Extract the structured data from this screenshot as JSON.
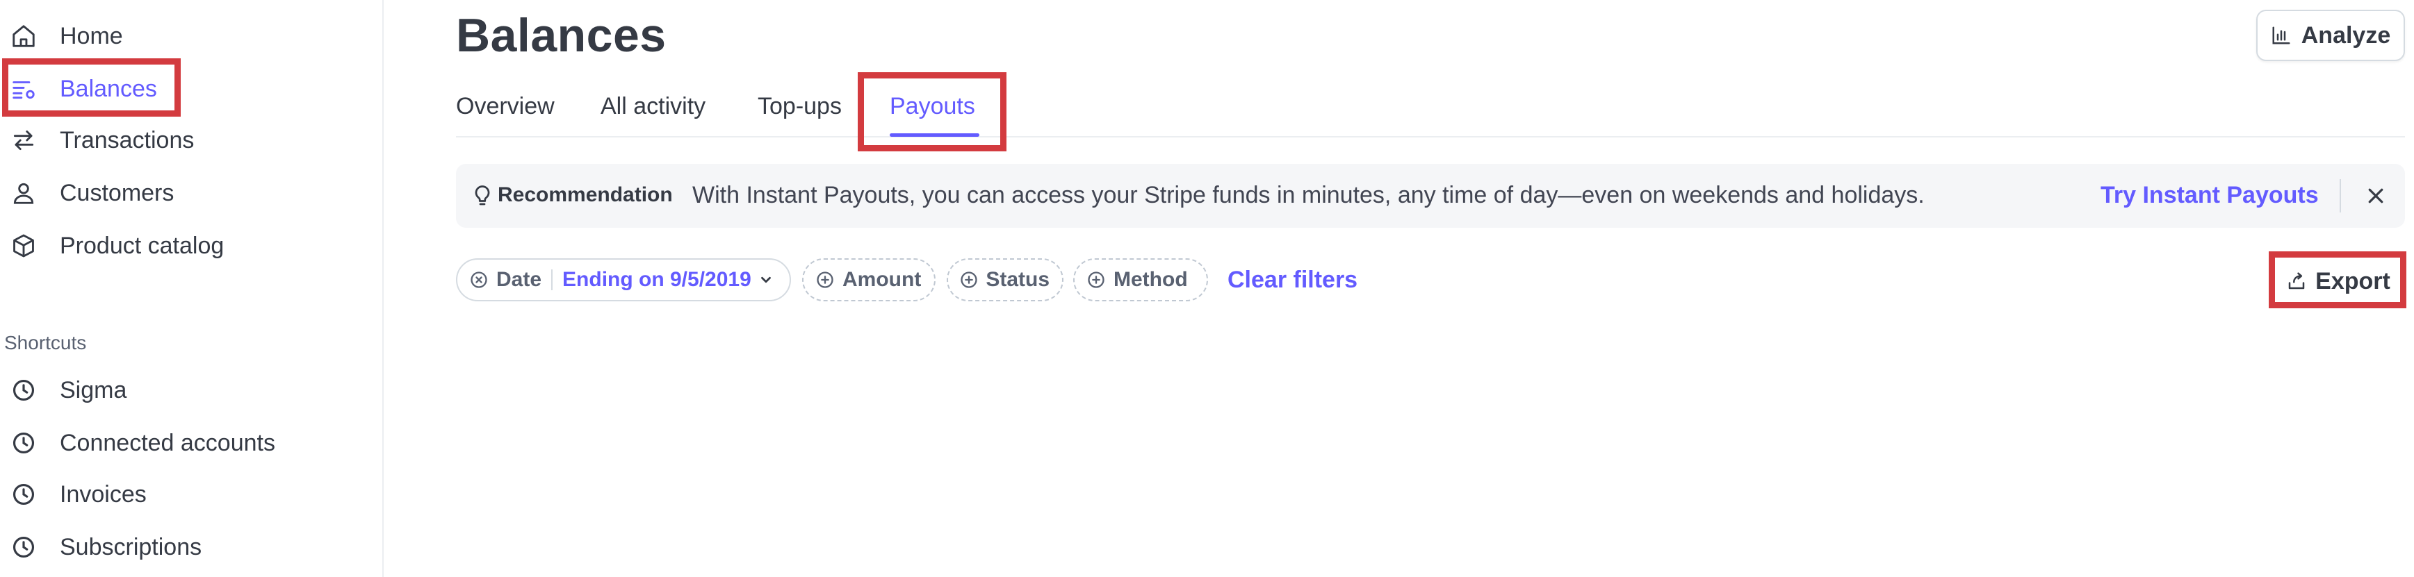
{
  "sidebar": {
    "items": [
      {
        "label": "Home",
        "icon": "home-icon"
      },
      {
        "label": "Balances",
        "icon": "balances-icon",
        "active": true
      },
      {
        "label": "Transactions",
        "icon": "transactions-icon"
      },
      {
        "label": "Customers",
        "icon": "customers-icon"
      },
      {
        "label": "Product catalog",
        "icon": "product-catalog-icon"
      }
    ],
    "shortcuts_title": "Shortcuts",
    "shortcuts": [
      {
        "label": "Sigma",
        "icon": "clock-icon"
      },
      {
        "label": "Connected accounts",
        "icon": "clock-icon"
      },
      {
        "label": "Invoices",
        "icon": "clock-icon"
      },
      {
        "label": "Subscriptions",
        "icon": "clock-icon"
      }
    ]
  },
  "header": {
    "title": "Balances",
    "analyze_label": "Analyze"
  },
  "tabs": [
    {
      "label": "Overview"
    },
    {
      "label": "All activity"
    },
    {
      "label": "Top-ups"
    },
    {
      "label": "Payouts",
      "active": true
    }
  ],
  "banner": {
    "tag": "Recommendation",
    "text": "With Instant Payouts, you can access your Stripe funds in minutes, any time of day—even on weekends and holidays.",
    "link": "Try Instant Payouts"
  },
  "filters": {
    "date_label": "Date",
    "date_value": "Ending on 9/5/2019",
    "amount_label": "Amount",
    "status_label": "Status",
    "method_label": "Method",
    "clear_label": "Clear filters"
  },
  "export_label": "Export",
  "colors": {
    "accent": "#635bff",
    "text": "#353a44",
    "highlight": "#d33b3f",
    "banner_bg": "#f5f6f8"
  }
}
